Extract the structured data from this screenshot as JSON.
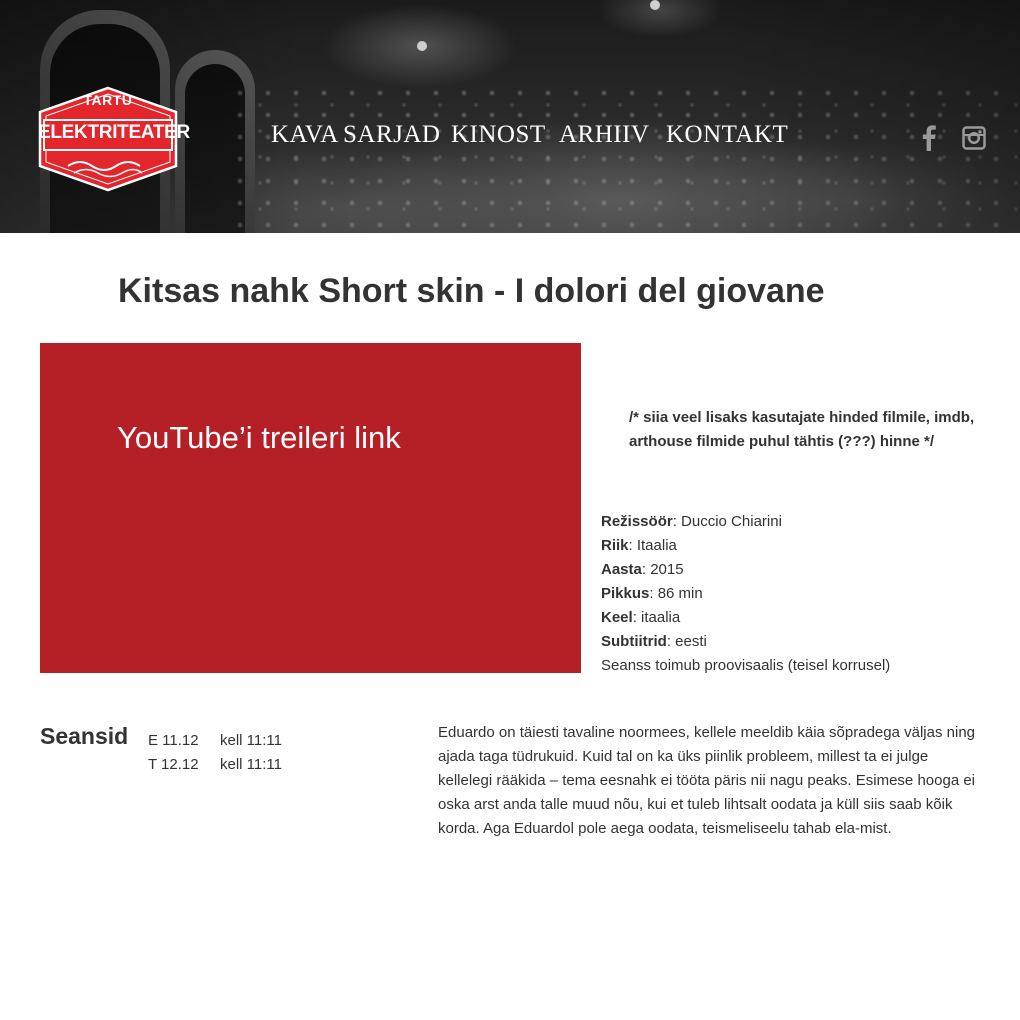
{
  "brand": {
    "logo_top": "TARTU",
    "logo_main": "ELEKTRITEATER",
    "red": "#e2262c",
    "dark_red": "#b52027"
  },
  "nav": {
    "items": [
      {
        "label": "KAVA"
      },
      {
        "label": "SARJAD"
      },
      {
        "label": "KINOST"
      },
      {
        "label": "ARHIIV"
      },
      {
        "label": "KONTAKT"
      }
    ]
  },
  "social": {
    "facebook_icon": "facebook-icon",
    "instagram_icon": "instagram-icon"
  },
  "film": {
    "title_et": "Kitsas nahk",
    "title_original": "Short skin - I dolori del giovane",
    "trailer_placeholder": "YouTube’i treileri link",
    "ratings_comment": "/* siia veel lisaks kasutajate hinded filmile, imdb, arthouse filmide puhul tähtis (???) hinne */",
    "facts": [
      {
        "label": "Režissöör",
        "value": ": Duccio Chiarini"
      },
      {
        "label": "Riik",
        "value": ": Itaalia"
      },
      {
        "label": "Aasta",
        "value": ": 2015"
      },
      {
        "label": "Pikkus",
        "value": ": 86 min"
      },
      {
        "label": "Keel",
        "value": ": itaalia"
      },
      {
        "label": "Subtiitrid",
        "value": ": eesti"
      }
    ],
    "venue_note": "Seanss toimub proovisaalis (teisel korrusel)",
    "description": "Eduardo on täiesti tavaline noormees, kellele meeldib käia sõpradega väljas ning ajada taga tüdrukuid. Kuid tal on ka üks piinlik probleem, millest ta ei julge kellelegi rääkida – tema eesnahk ei tööta päris nii nagu peaks. Esimese hooga ei oska arst anda talle muud nõu, kui et tuleb lihtsalt oodata ja küll siis saab kõik korda. Aga Eduardol pole aega oodata, teismeliseelu tahab ela-mist."
  },
  "screenings": {
    "heading": "Seansid",
    "items": [
      {
        "date": "E 11.12",
        "time": "kell 11:11"
      },
      {
        "date": "T 12.12",
        "time": "kell 11:11"
      }
    ]
  }
}
